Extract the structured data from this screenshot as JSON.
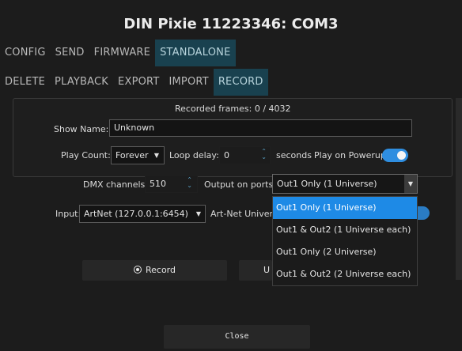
{
  "window": {
    "title": "DIN Pixie 11223346: COM3"
  },
  "main_tabs": [
    {
      "label": "CONFIG"
    },
    {
      "label": "SEND"
    },
    {
      "label": "FIRMWARE"
    },
    {
      "label": "STANDALONE"
    }
  ],
  "sub_tabs": [
    {
      "label": "DELETE"
    },
    {
      "label": "PLAYBACK"
    },
    {
      "label": "EXPORT"
    },
    {
      "label": "IMPORT"
    },
    {
      "label": "RECORD"
    }
  ],
  "recorded_frames": {
    "label": "Recorded frames:",
    "current": "0",
    "separator": "/",
    "total": "4032"
  },
  "show_name": {
    "label": "Show Name:",
    "value": "Unknown"
  },
  "play_count": {
    "label": "Play Count:",
    "value": "Forever"
  },
  "loop_delay": {
    "label": "Loop delay:",
    "value": "0",
    "unit": "seconds"
  },
  "play_on_powerup": {
    "label": "Play on Powerup:",
    "enabled": true
  },
  "dmx_channels": {
    "label": "DMX channels:",
    "value": "510"
  },
  "output_ports": {
    "label": "Output on ports",
    "value": "Out1 Only (1 Universe)",
    "options": [
      "Out1 Only (1 Universe)",
      "Out1 & Out2 (1 Universe each)",
      "Out1 Only (2 Universe)",
      "Out1 & Out2 (2 Universe each)"
    ]
  },
  "input": {
    "label": "Input:",
    "value": "ArtNet (127.0.0.1:6454)"
  },
  "artnet_universe": {
    "label": "Art-Net Universe"
  },
  "buttons": {
    "record": "Record",
    "second_partial": "U",
    "close": "Close"
  },
  "icons": {
    "record": "record-icon",
    "dropdown": "chevron-down-icon",
    "spinner": "spinner-arrows-icon"
  },
  "colors": {
    "accent": "#2f8ee0",
    "tab_active_bg": "#19414f",
    "selected_option": "#1e8ae6"
  }
}
